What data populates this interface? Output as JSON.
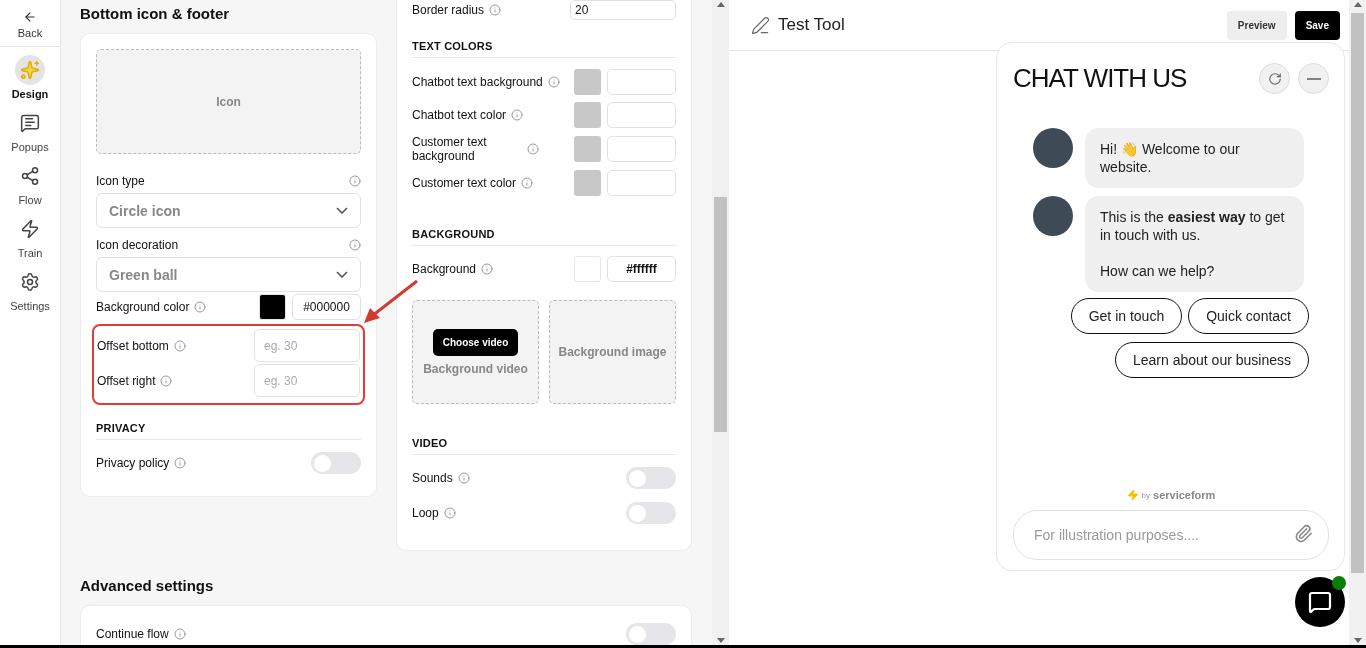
{
  "sidebar": {
    "back": "Back",
    "items": [
      {
        "label": "Design",
        "selected": true
      },
      {
        "label": "Popups",
        "selected": false
      },
      {
        "label": "Flow",
        "selected": false
      },
      {
        "label": "Train",
        "selected": false
      },
      {
        "label": "Settings",
        "selected": false
      }
    ]
  },
  "bottom_icon_section": {
    "title": "Bottom icon & footer",
    "icon_upload": "Icon",
    "selects": [
      {
        "label": "Icon type",
        "value": "Circle icon"
      },
      {
        "label": "Icon decoration",
        "value": "Green ball"
      }
    ],
    "background_color": {
      "label": "Background color",
      "color": "#000000",
      "value": "#000000"
    },
    "offsets": [
      {
        "label": "Offset bottom",
        "placeholder": "eg. 30"
      },
      {
        "label": "Offset right",
        "placeholder": "eg. 30"
      }
    ],
    "privacy": {
      "heading": "PRIVACY",
      "toggles": [
        {
          "label": "Privacy policy",
          "on": false
        }
      ]
    }
  },
  "style_section": {
    "border_radius": {
      "label": "Border radius",
      "value": "20"
    },
    "text_colors": {
      "heading": "TEXT COLORS",
      "rows": [
        {
          "label": "Chatbot text background",
          "color": "#c8c8c8"
        },
        {
          "label": "Chatbot text color",
          "color": "#c8c8c8"
        },
        {
          "label": "Customer text background",
          "color": "#c8c8c8"
        },
        {
          "label": "Customer text color",
          "color": "#c8c8c8"
        }
      ]
    },
    "background": {
      "heading": "BACKGROUND",
      "label": "Background",
      "color": "#ffffff",
      "value": "#ffffff",
      "tiles": [
        {
          "label": "Background video",
          "button": "Choose video"
        },
        {
          "label": "Background image"
        }
      ]
    },
    "video": {
      "heading": "VIDEO",
      "toggles": [
        {
          "label": "Sounds",
          "on": false
        },
        {
          "label": "Loop",
          "on": false
        }
      ]
    }
  },
  "advanced": {
    "title": "Advanced settings",
    "toggles": [
      {
        "label": "Continue flow",
        "on": false
      }
    ]
  },
  "preview": {
    "title": "Test Tool",
    "buttons": [
      {
        "label": "Preview",
        "kind": "secondary"
      },
      {
        "label": "Save",
        "kind": "primary"
      }
    ],
    "chat": {
      "title": "CHAT WITH US",
      "messages": [
        {
          "paragraphs": [
            "Hi! 👋 Welcome to our website."
          ]
        },
        {
          "paragraphs": [
            "This is the **easiest way** to get in touch with us.",
            "How can we help?"
          ]
        }
      ],
      "quick_replies": [
        "Get in touch",
        "Quick contact",
        "Learn about our business"
      ],
      "footer_by": "by",
      "footer_brand": "serviceform",
      "input_placeholder": "For illustration purposes....",
      "launcher_online": true
    }
  }
}
